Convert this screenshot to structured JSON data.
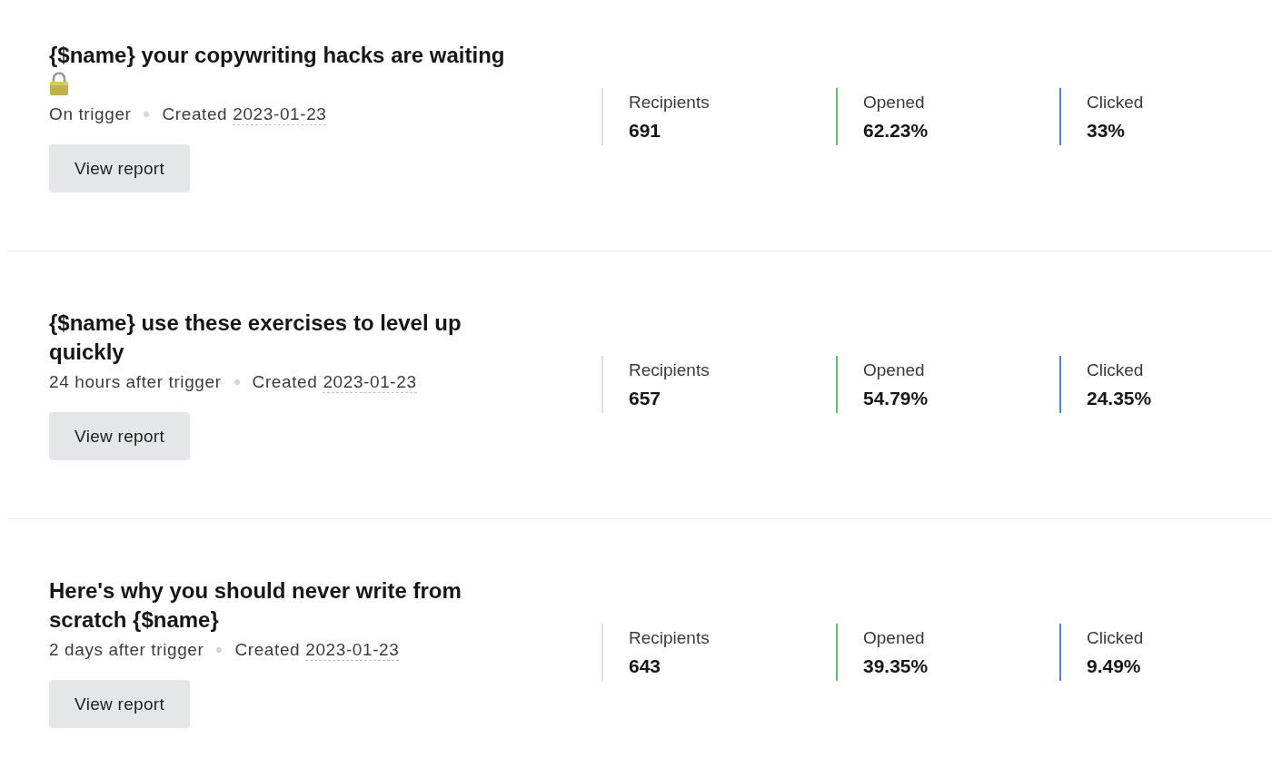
{
  "campaigns": [
    {
      "title": "{$name} your copywriting hacks are waiting",
      "title_icon": true,
      "schedule": "On trigger",
      "created_label": "Created",
      "created_date": "2023-01-23",
      "button": "View report",
      "stats": [
        {
          "label": "Recipients",
          "value": "691",
          "color": "#dedede"
        },
        {
          "label": "Opened",
          "value": "62.23%",
          "color": "#62b978"
        },
        {
          "label": "Clicked",
          "value": "33%",
          "color": "#5a80cf"
        }
      ]
    },
    {
      "title": "{$name} use these exercises to level up quickly",
      "title_icon": false,
      "schedule": "24 hours after trigger",
      "created_label": "Created",
      "created_date": "2023-01-23",
      "button": "View report",
      "stats": [
        {
          "label": "Recipients",
          "value": "657",
          "color": "#dedede"
        },
        {
          "label": "Opened",
          "value": "54.79%",
          "color": "#62b978"
        },
        {
          "label": "Clicked",
          "value": "24.35%",
          "color": "#5a80cf"
        }
      ]
    },
    {
      "title": "Here's why you should never write from scratch {$name}",
      "title_icon": false,
      "schedule": "2 days after trigger",
      "created_label": "Created",
      "created_date": "2023-01-23",
      "button": "View report",
      "stats": [
        {
          "label": "Recipients",
          "value": "643",
          "color": "#dedede"
        },
        {
          "label": "Opened",
          "value": "39.35%",
          "color": "#62b978"
        },
        {
          "label": "Clicked",
          "value": "9.49%",
          "color": "#5a80cf"
        }
      ]
    }
  ]
}
